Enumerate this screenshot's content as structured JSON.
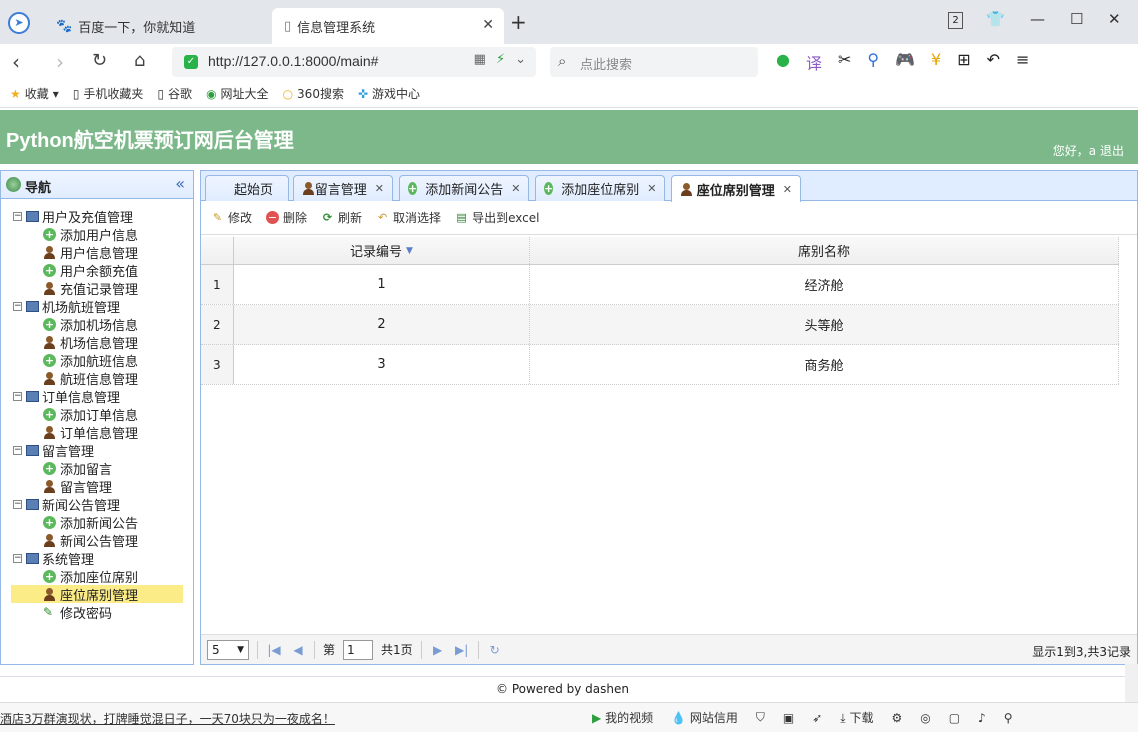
{
  "browser": {
    "tabs": [
      {
        "title": "百度一下，你就知道"
      },
      {
        "title": "信息管理系统"
      }
    ],
    "tab_count": "2",
    "url": "http://127.0.0.1:8000/main#",
    "search_placeholder": "点此搜索",
    "bookmarks": [
      "收藏",
      "手机收藏夹",
      "谷歌",
      "网址大全",
      "360搜索",
      "游戏中心"
    ]
  },
  "header": {
    "title": "Python航空机票预订网后台管理",
    "greeting": "您好，a",
    "logout": "退出"
  },
  "nav": {
    "title": "导航",
    "groups": [
      {
        "label": "用户及充值管理",
        "items": [
          "添加用户信息",
          "用户信息管理",
          "用户余额充值",
          "充值记录管理"
        ]
      },
      {
        "label": "机场航班管理",
        "items": [
          "添加机场信息",
          "机场信息管理",
          "添加航班信息",
          "航班信息管理"
        ]
      },
      {
        "label": "订单信息管理",
        "items": [
          "添加订单信息",
          "订单信息管理"
        ]
      },
      {
        "label": "留言管理",
        "items": [
          "添加留言",
          "留言管理"
        ]
      },
      {
        "label": "新闻公告管理",
        "items": [
          "添加新闻公告",
          "新闻公告管理"
        ]
      },
      {
        "label": "系统管理",
        "items": [
          "添加座位席别",
          "座位席别管理",
          "修改密码"
        ]
      }
    ]
  },
  "main": {
    "tabs": [
      "起始页",
      "留言管理",
      "添加新闻公告",
      "添加座位席别",
      "座位席别管理"
    ],
    "toolbar": [
      "修改",
      "删除",
      "刷新",
      "取消选择",
      "导出到excel"
    ],
    "columns": [
      "记录编号",
      "席别名称"
    ],
    "rows": [
      {
        "rn": "1",
        "id": "1",
        "name": "经济舱"
      },
      {
        "rn": "2",
        "id": "2",
        "name": "头等舱"
      },
      {
        "rn": "3",
        "id": "3",
        "name": "商务舱"
      }
    ],
    "pager": {
      "page_size": "5",
      "page_prefix": "第",
      "page": "1",
      "page_total": "共1页",
      "info": "显示1到3,共3记录"
    }
  },
  "footer": "© Powered by dashen",
  "statusbar": {
    "news": "酒店3万群演现状，打牌睡觉混日子，一天70块只为一夜成名！",
    "items": [
      "我的视频",
      "网站信用",
      "下载"
    ]
  }
}
